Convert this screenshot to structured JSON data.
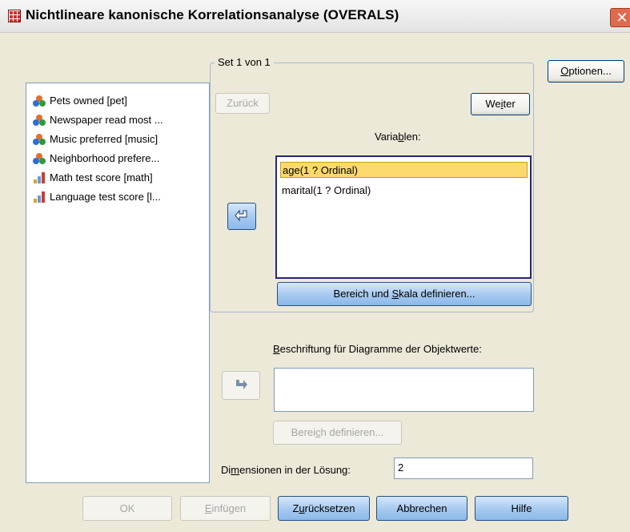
{
  "window": {
    "title": "Nichtlineare kanonische Korrelationsanalyse (OVERALS)",
    "close_glyph": "✕"
  },
  "source_variables": [
    {
      "label": "Pets owned [pet]",
      "icon": "nominal-icon"
    },
    {
      "label": "Newspaper read most ...",
      "icon": "nominal-icon"
    },
    {
      "label": "Music preferred [music]",
      "icon": "nominal-icon"
    },
    {
      "label": "Neighborhood prefere...",
      "icon": "nominal-icon"
    },
    {
      "label": "Math test score [math]",
      "icon": "scale-icon"
    },
    {
      "label": "Language test score [l...",
      "icon": "scale-icon"
    }
  ],
  "set_group": {
    "label": "Set 1  von 1",
    "back_button": "Zurück",
    "next_button": "Weiter",
    "variables_label": "Variablen:",
    "variables": [
      "age(1 ? Ordinal)",
      "marital(1 ? Ordinal)"
    ],
    "selected_index": 0,
    "define_range_scale_button": "Bereich und Skala definieren..."
  },
  "options_button": "Optionen...",
  "object_labels": {
    "label": "Beschriftung für Diagramme der Objektwerte:",
    "define_range_button": "Bereich definieren..."
  },
  "dimensions": {
    "label": "Dimensionen in der Lösung:",
    "value": "2"
  },
  "footer": {
    "ok": "OK",
    "paste": "Einfügen",
    "reset": "Zurücksetzen",
    "cancel": "Abbrechen",
    "help": "Hilfe"
  },
  "colors": {
    "button_border": "#003c74",
    "highlight": "#fbd96b",
    "disabled_text": "#a6a6a6"
  }
}
